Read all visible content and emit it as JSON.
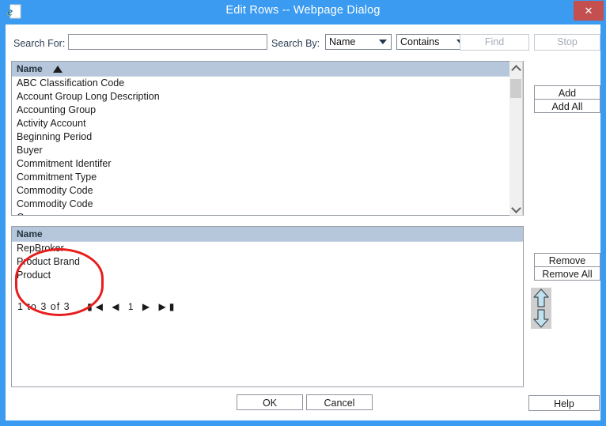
{
  "window": {
    "title": "Edit Rows -- Webpage Dialog",
    "app_icon": "internet-explorer-icon",
    "close_label": "✕",
    "accent_color": "#3a9bf0",
    "close_color": "#c44f4f"
  },
  "search": {
    "search_for_label": "Search For:",
    "search_for_value": "",
    "search_for_placeholder": "",
    "search_by_label": "Search By:",
    "search_by_value": "Name",
    "match_value": "Contains",
    "find_label": "Find",
    "stop_label": "Stop",
    "find_enabled": false,
    "stop_enabled": false
  },
  "available_list": {
    "header": "Name",
    "sort_direction": "ascending",
    "rows": [
      "ABC Classification Code",
      "Account Group Long Description",
      "Accounting Group",
      "Activity Account",
      "Beginning Period",
      "Buyer",
      "Commitment Identifer",
      "Commitment Type",
      "Commodity Code",
      "Commodity Code"
    ],
    "clipped_row": "C"
  },
  "selected_list": {
    "header": "Name",
    "rows": [
      "RepBroker",
      "Product Brand",
      "Product"
    ]
  },
  "pager": {
    "range_text": "1 to 3 of 3",
    "first_label": "▮◀",
    "prev_label": "◀",
    "page_label": "1",
    "next_label": "▶",
    "last_label": "▶▮"
  },
  "transfer_buttons": {
    "add": "Add",
    "add_all": "Add All",
    "remove": "Remove",
    "remove_all": "Remove All",
    "move_up": "move-up",
    "move_down": "move-down"
  },
  "footer": {
    "ok": "OK",
    "cancel": "Cancel",
    "help": "Help"
  },
  "annotation": {
    "shape": "ellipse",
    "color": "#e81d1d"
  }
}
